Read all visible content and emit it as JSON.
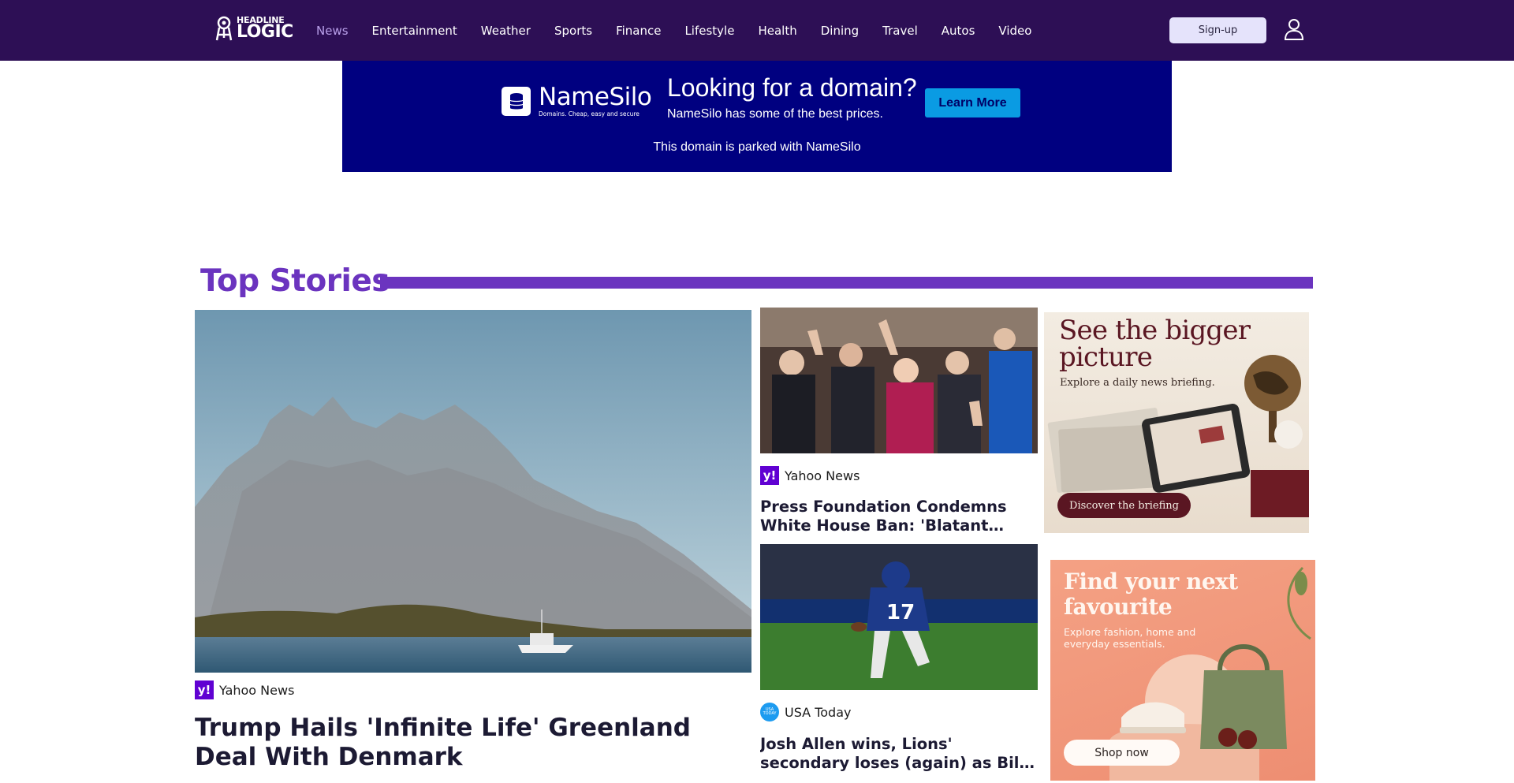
{
  "header": {
    "logo_line1": "HEADLINE",
    "logo_line2": "LOGIC",
    "nav": [
      {
        "label": "News",
        "active": true
      },
      {
        "label": "Entertainment"
      },
      {
        "label": "Weather"
      },
      {
        "label": "Sports"
      },
      {
        "label": "Finance"
      },
      {
        "label": "Lifestyle"
      },
      {
        "label": "Health"
      },
      {
        "label": "Dining"
      },
      {
        "label": "Travel"
      },
      {
        "label": "Autos"
      },
      {
        "label": "Video"
      }
    ],
    "signup_label": "Sign-up",
    "user_icon": "user-icon"
  },
  "banner_ad": {
    "brand": "NameSilo",
    "tagline": "Domains. Cheap, easy and secure",
    "headline": "Looking for a domain?",
    "subline": "NameSilo has some of the best prices.",
    "cta": "Learn More",
    "footer": "This domain is parked with NameSilo",
    "bg_color": "#000080"
  },
  "top_stories": {
    "title": "Top Stories",
    "accent_color": "#6b34bf",
    "lead": {
      "source": "Yahoo News",
      "source_icon": "yahoo-icon",
      "headline": "Trump Hails 'Infinite Life' Greenland Deal With Denmark"
    },
    "secondary": [
      {
        "source": "Yahoo News",
        "source_icon": "yahoo-icon",
        "headline": "Press Foundation Condemns White House Ban: 'Blatant Retaliation'"
      },
      {
        "source": "USA Today",
        "source_icon": "usa-today-icon",
        "headline": "Josh Allen wins, Lions' secondary loses (again) as Bills beat Detroit"
      }
    ]
  },
  "side_ads": [
    {
      "title": "See the bigger picture",
      "subtitle": "Explore a daily news briefing.",
      "cta": "Discover the briefing"
    },
    {
      "title": "Find your next favourite",
      "subtitle": "Explore fashion, home and everyday essentials.",
      "cta": "Shop now"
    }
  ]
}
